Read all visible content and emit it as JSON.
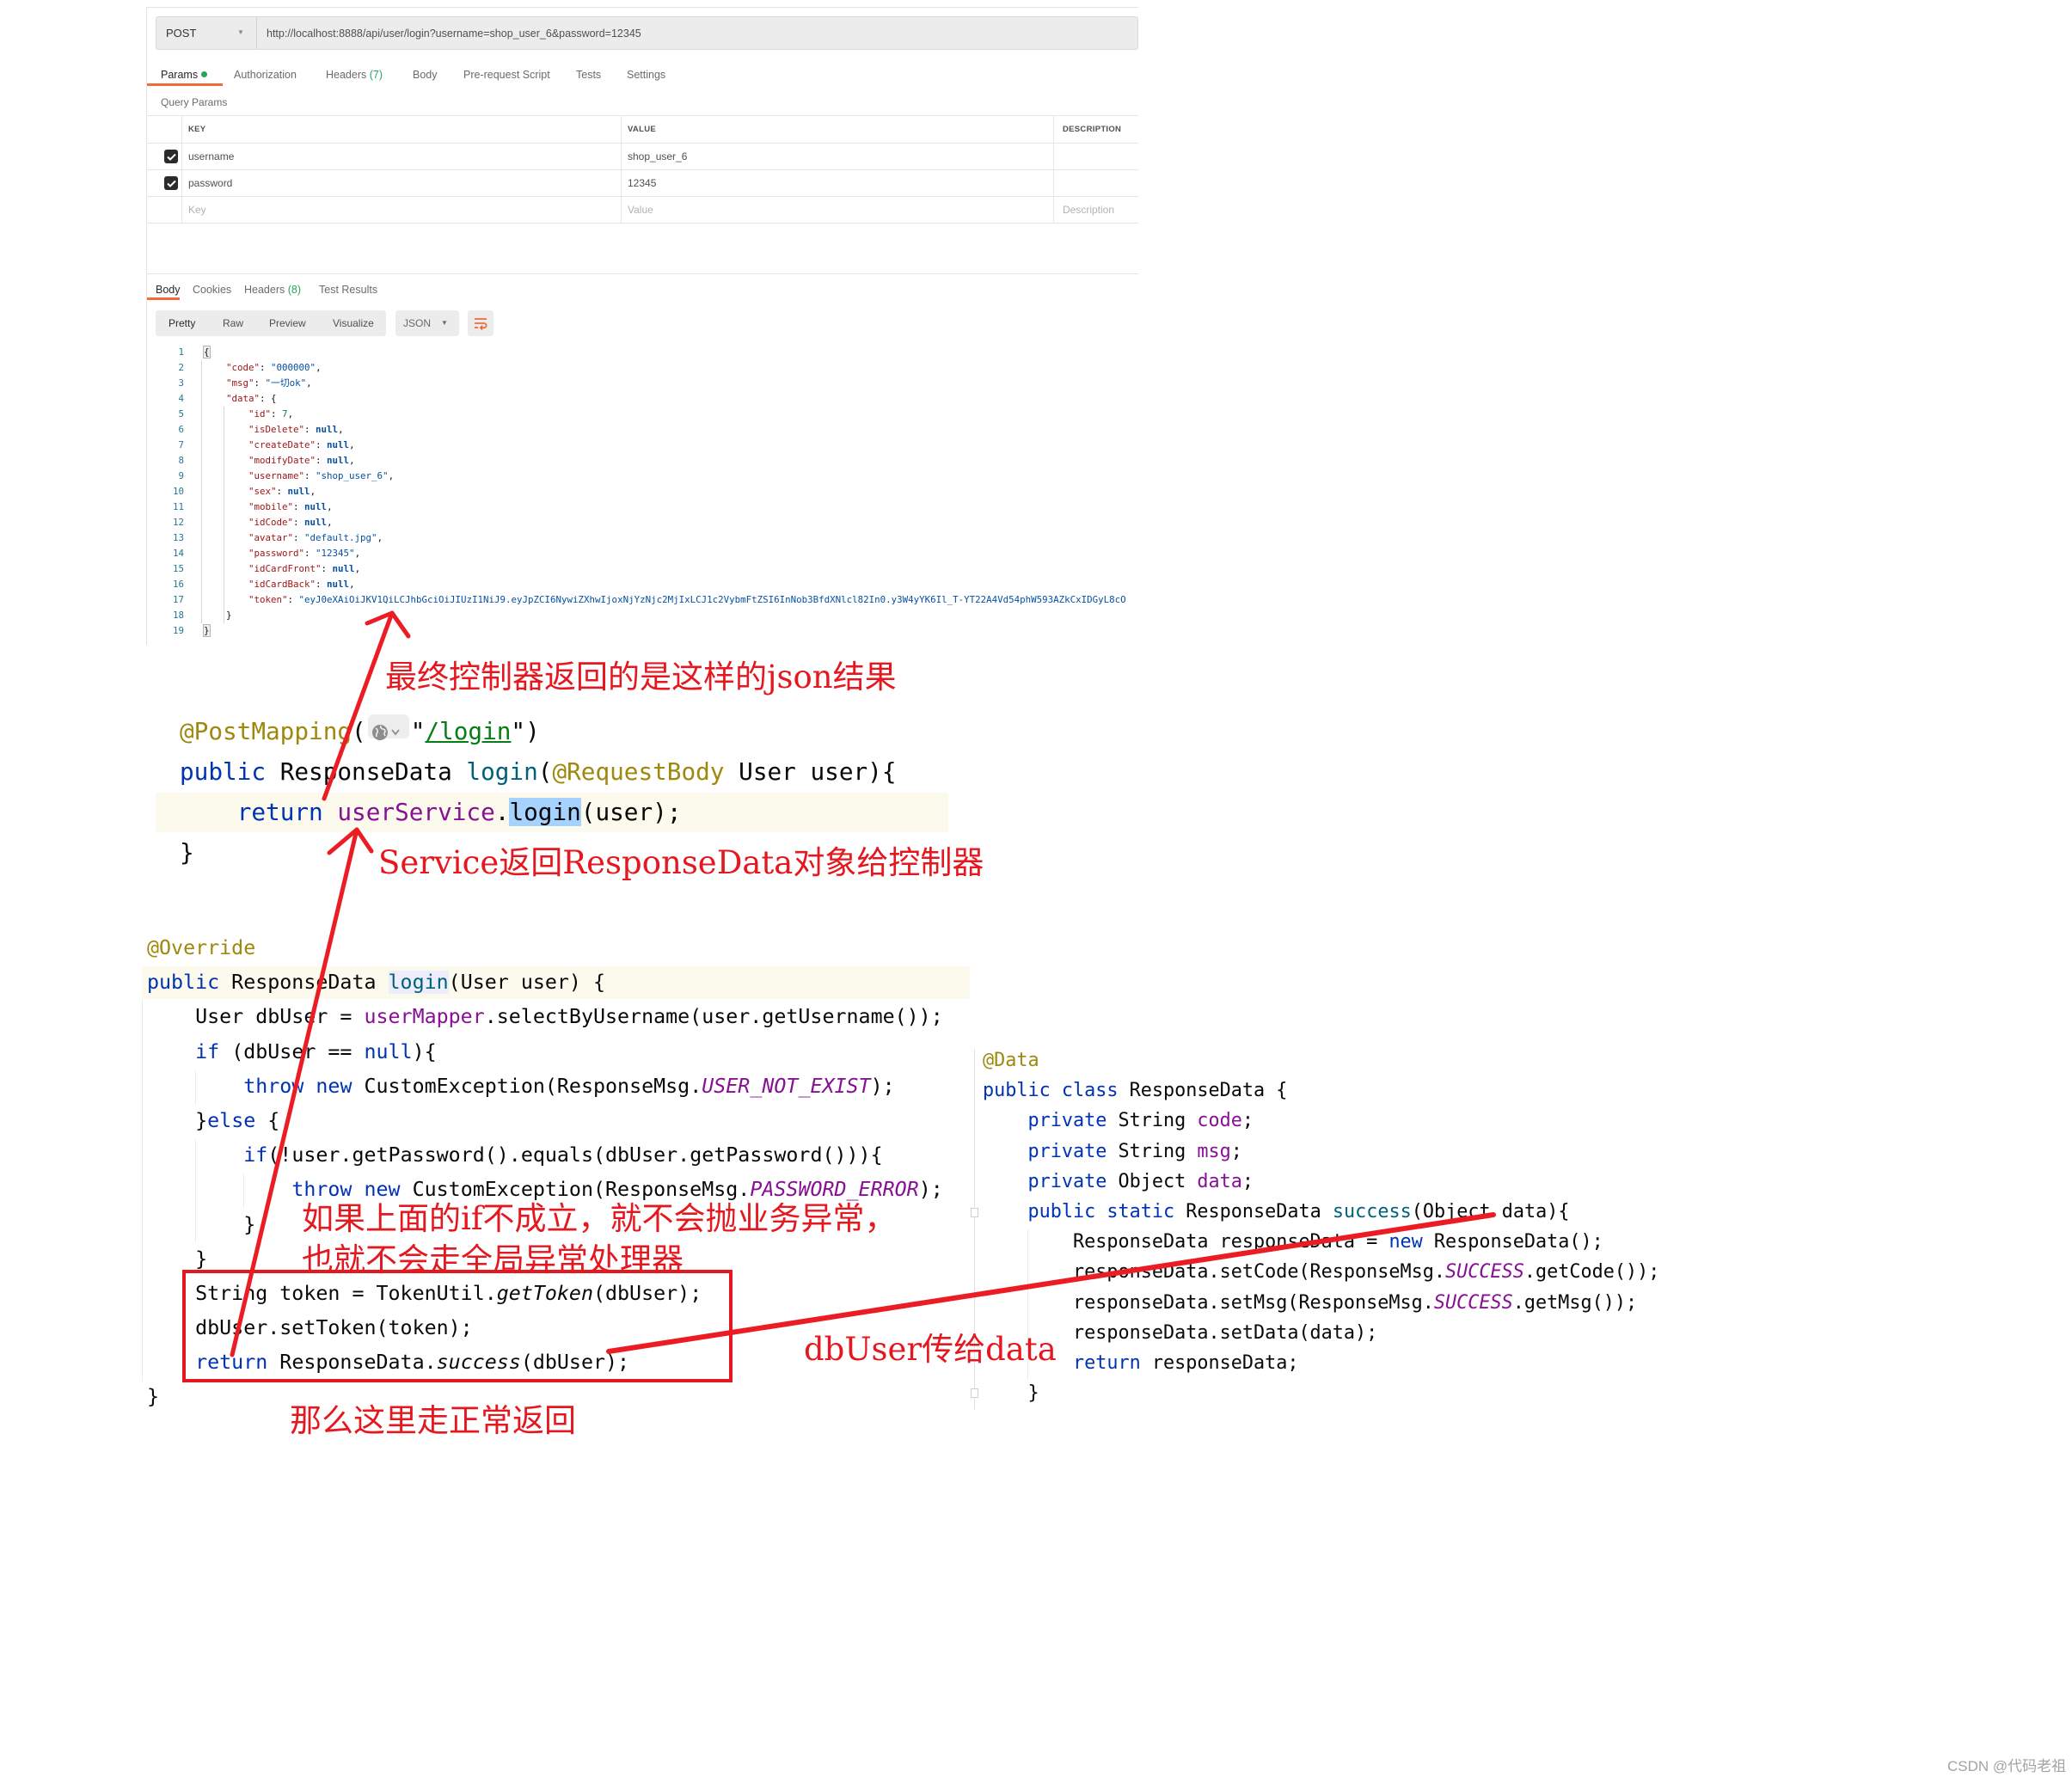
{
  "colors": {
    "postman_accent": "#f26b3a",
    "param_indicator": "#26a65b",
    "annotation_red": "#e5171f"
  },
  "postman": {
    "request": {
      "method": "POST",
      "url": "http://localhost:8888/api/user/login?username=shop_user_6&password=12345"
    },
    "request_tabs": [
      {
        "label": "Params",
        "active": true,
        "indicator": "green-dot"
      },
      {
        "label": "Authorization"
      },
      {
        "label": "Headers",
        "count": "(7)"
      },
      {
        "label": "Body"
      },
      {
        "label": "Pre-request Script"
      },
      {
        "label": "Tests"
      },
      {
        "label": "Settings"
      }
    ],
    "query_params_title": "Query Params",
    "params_table": {
      "headers": [
        "KEY",
        "VALUE",
        "DESCRIPTION"
      ],
      "rows": [
        {
          "checked": true,
          "key": "username",
          "value": "shop_user_6",
          "description": ""
        },
        {
          "checked": true,
          "key": "password",
          "value": "12345",
          "description": ""
        }
      ],
      "placeholders": {
        "key": "Key",
        "value": "Value",
        "description": "Description"
      }
    },
    "response_tabs": [
      {
        "label": "Body",
        "active": true
      },
      {
        "label": "Cookies"
      },
      {
        "label": "Headers",
        "count": "(8)"
      },
      {
        "label": "Test Results"
      }
    ],
    "view_modes": [
      "Pretty",
      "Raw",
      "Preview",
      "Visualize"
    ],
    "format": "JSON",
    "wrap_icon": "wrap-lines-icon",
    "response_lines": [
      {
        "n": "1",
        "tokens": [
          [
            "{",
            "brace"
          ]
        ]
      },
      {
        "n": "2",
        "tokens": [
          [
            "    ",
            "p"
          ],
          [
            "\"code\"",
            "key"
          ],
          [
            ": ",
            "p"
          ],
          [
            "\"000000\"",
            "str"
          ],
          [
            ",",
            "p"
          ]
        ]
      },
      {
        "n": "3",
        "tokens": [
          [
            "    ",
            "p"
          ],
          [
            "\"msg\"",
            "key"
          ],
          [
            ": ",
            "p"
          ],
          [
            "\"一切ok\"",
            "str"
          ],
          [
            ",",
            "p"
          ]
        ]
      },
      {
        "n": "4",
        "tokens": [
          [
            "    ",
            "p"
          ],
          [
            "\"data\"",
            "key"
          ],
          [
            ": {",
            "p"
          ]
        ]
      },
      {
        "n": "5",
        "tokens": [
          [
            "        ",
            "p"
          ],
          [
            "\"id\"",
            "key"
          ],
          [
            ": ",
            "p"
          ],
          [
            "7",
            "num"
          ],
          [
            ",",
            "p"
          ]
        ]
      },
      {
        "n": "6",
        "tokens": [
          [
            "        ",
            "p"
          ],
          [
            "\"isDelete\"",
            "key"
          ],
          [
            ": ",
            "p"
          ],
          [
            "null",
            "null"
          ],
          [
            ",",
            "p"
          ]
        ]
      },
      {
        "n": "7",
        "tokens": [
          [
            "        ",
            "p"
          ],
          [
            "\"createDate\"",
            "key"
          ],
          [
            ": ",
            "p"
          ],
          [
            "null",
            "null"
          ],
          [
            ",",
            "p"
          ]
        ]
      },
      {
        "n": "8",
        "tokens": [
          [
            "        ",
            "p"
          ],
          [
            "\"modifyDate\"",
            "key"
          ],
          [
            ": ",
            "p"
          ],
          [
            "null",
            "null"
          ],
          [
            ",",
            "p"
          ]
        ]
      },
      {
        "n": "9",
        "tokens": [
          [
            "        ",
            "p"
          ],
          [
            "\"username\"",
            "key"
          ],
          [
            ": ",
            "p"
          ],
          [
            "\"shop_user_6\"",
            "str"
          ],
          [
            ",",
            "p"
          ]
        ]
      },
      {
        "n": "10",
        "tokens": [
          [
            "        ",
            "p"
          ],
          [
            "\"sex\"",
            "key"
          ],
          [
            ": ",
            "p"
          ],
          [
            "null",
            "null"
          ],
          [
            ",",
            "p"
          ]
        ]
      },
      {
        "n": "11",
        "tokens": [
          [
            "        ",
            "p"
          ],
          [
            "\"mobile\"",
            "key"
          ],
          [
            ": ",
            "p"
          ],
          [
            "null",
            "null"
          ],
          [
            ",",
            "p"
          ]
        ]
      },
      {
        "n": "12",
        "tokens": [
          [
            "        ",
            "p"
          ],
          [
            "\"idCode\"",
            "key"
          ],
          [
            ": ",
            "p"
          ],
          [
            "null",
            "null"
          ],
          [
            ",",
            "p"
          ]
        ]
      },
      {
        "n": "13",
        "tokens": [
          [
            "        ",
            "p"
          ],
          [
            "\"avatar\"",
            "key"
          ],
          [
            ": ",
            "p"
          ],
          [
            "\"default.jpg\"",
            "str"
          ],
          [
            ",",
            "p"
          ]
        ]
      },
      {
        "n": "14",
        "tokens": [
          [
            "        ",
            "p"
          ],
          [
            "\"password\"",
            "key"
          ],
          [
            ": ",
            "p"
          ],
          [
            "\"12345\"",
            "str"
          ],
          [
            ",",
            "p"
          ]
        ]
      },
      {
        "n": "15",
        "tokens": [
          [
            "        ",
            "p"
          ],
          [
            "\"idCardFront\"",
            "key"
          ],
          [
            ": ",
            "p"
          ],
          [
            "null",
            "null"
          ],
          [
            ",",
            "p"
          ]
        ]
      },
      {
        "n": "16",
        "tokens": [
          [
            "        ",
            "p"
          ],
          [
            "\"idCardBack\"",
            "key"
          ],
          [
            ": ",
            "p"
          ],
          [
            "null",
            "null"
          ],
          [
            ",",
            "p"
          ]
        ]
      },
      {
        "n": "17",
        "tokens": [
          [
            "        ",
            "p"
          ],
          [
            "\"token\"",
            "key"
          ],
          [
            ": ",
            "p"
          ],
          [
            "\"eyJ0eXAiOiJKV1QiLCJhbGciOiJIUzI1NiJ9.eyJpZCI6NywiZXhwIjoxNjYzNjc2MjIxLCJ1c2VybmFtZSI6InNob3BfdXNlcl82In0.y3W4yYK6Il_T-YT22A4Vd54phW593AZkCxIDGyL8cO",
            "str"
          ]
        ]
      },
      {
        "n": "18",
        "tokens": [
          [
            "    ",
            "p"
          ],
          [
            "}",
            "p"
          ]
        ]
      },
      {
        "n": "19",
        "tokens": [
          [
            "}",
            "brace"
          ]
        ]
      }
    ]
  },
  "controller_code": [
    {
      "tokens": [
        [
          "@PostMapping",
          "a"
        ],
        [
          "(",
          "p"
        ],
        [
          "",
          "globe"
        ],
        [
          "\"",
          "p"
        ],
        [
          "/login",
          "s"
        ],
        [
          "\"",
          "p"
        ],
        [
          ")",
          "p"
        ]
      ]
    },
    {
      "tokens": [
        [
          "public",
          "k"
        ],
        [
          " ResponseData ",
          "p"
        ],
        [
          "login",
          "f"
        ],
        [
          "(",
          "p"
        ],
        [
          "@RequestBody",
          "a"
        ],
        [
          " User user){",
          "p"
        ]
      ]
    },
    {
      "tokens": [
        [
          "    ",
          "p"
        ],
        [
          "return",
          "k"
        ],
        [
          " ",
          "p"
        ],
        [
          "userService",
          "v"
        ],
        [
          ".",
          "p"
        ],
        [
          "login",
          "sel"
        ],
        [
          "(user);",
          "p"
        ]
      ]
    },
    {
      "tokens": [
        [
          "}",
          "p"
        ]
      ]
    }
  ],
  "service_code": [
    {
      "tokens": [
        [
          "@Override",
          "a"
        ]
      ]
    },
    {
      "tokens": [
        [
          "public",
          "k"
        ],
        [
          " ResponseData ",
          "p"
        ],
        [
          "login",
          "hl"
        ],
        [
          "(User user) {",
          "p"
        ]
      ]
    },
    {
      "tokens": [
        [
          "    User dbUser = ",
          "p"
        ],
        [
          "userMapper",
          "v"
        ],
        [
          ".selectByUsername(user.getUsername());",
          "p"
        ]
      ]
    },
    {
      "tokens": [
        [
          "    ",
          "p"
        ],
        [
          "if",
          "k"
        ],
        [
          " (dbUser == ",
          "p"
        ],
        [
          "null",
          "k"
        ],
        [
          "){",
          "p"
        ]
      ]
    },
    {
      "tokens": [
        [
          "        ",
          "p"
        ],
        [
          "throw",
          "k"
        ],
        [
          " ",
          "p"
        ],
        [
          "new",
          "k"
        ],
        [
          " CustomException(ResponseMsg.",
          "p"
        ],
        [
          "USER_NOT_EXIST",
          "c"
        ],
        [
          ");",
          "p"
        ]
      ]
    },
    {
      "tokens": [
        [
          "    }",
          "p"
        ],
        [
          "else",
          "k"
        ],
        [
          " {",
          "p"
        ]
      ]
    },
    {
      "tokens": [
        [
          "        ",
          "p"
        ],
        [
          "if",
          "k"
        ],
        [
          "(!user.getPassword().equals(dbUser.getPassword())){",
          "p"
        ]
      ]
    },
    {
      "tokens": [
        [
          "            ",
          "p"
        ],
        [
          "throw",
          "k"
        ],
        [
          " ",
          "p"
        ],
        [
          "new",
          "k"
        ],
        [
          " CustomException(ResponseMsg.",
          "p"
        ],
        [
          "PASSWORD_ERROR",
          "c"
        ],
        [
          ");",
          "p"
        ]
      ]
    },
    {
      "tokens": [
        [
          "        }",
          "p"
        ]
      ]
    },
    {
      "tokens": [
        [
          "    }",
          "p"
        ]
      ]
    },
    {
      "tokens": [
        [
          "    String token = TokenUtil.",
          "p"
        ],
        [
          "getToken",
          "i"
        ],
        [
          "(dbUser);",
          "p"
        ]
      ]
    },
    {
      "tokens": [
        [
          "    dbUser.setToken(token);",
          "p"
        ]
      ]
    },
    {
      "tokens": [
        [
          "    ",
          "p"
        ],
        [
          "return",
          "k"
        ],
        [
          " ResponseData.",
          "p"
        ],
        [
          "success",
          "i"
        ],
        [
          "(dbUser);",
          "p"
        ]
      ]
    },
    {
      "tokens": [
        [
          "}",
          "p"
        ]
      ]
    }
  ],
  "response_class_code": [
    {
      "tokens": [
        [
          "@Data",
          "a"
        ]
      ]
    },
    {
      "tokens": [
        [
          "public",
          "k"
        ],
        [
          " ",
          "p"
        ],
        [
          "class",
          "k"
        ],
        [
          " ResponseData {",
          "p"
        ]
      ]
    },
    {
      "tokens": [
        [
          "    ",
          "p"
        ],
        [
          "private",
          "k"
        ],
        [
          " String ",
          "p"
        ],
        [
          "code",
          "v"
        ],
        [
          ";",
          "p"
        ]
      ]
    },
    {
      "tokens": [
        [
          "    ",
          "p"
        ],
        [
          "private",
          "k"
        ],
        [
          " String ",
          "p"
        ],
        [
          "msg",
          "v"
        ],
        [
          ";",
          "p"
        ]
      ]
    },
    {
      "tokens": [
        [
          "    ",
          "p"
        ],
        [
          "private",
          "k"
        ],
        [
          " Object ",
          "p"
        ],
        [
          "data",
          "v"
        ],
        [
          ";",
          "p"
        ]
      ]
    },
    {
      "tokens": [
        [
          "    ",
          "p"
        ],
        [
          "public",
          "k"
        ],
        [
          " ",
          "p"
        ],
        [
          "static",
          "k"
        ],
        [
          " ResponseData ",
          "p"
        ],
        [
          "success",
          "f"
        ],
        [
          "(Object data){",
          "p"
        ]
      ]
    },
    {
      "tokens": [
        [
          "        ResponseData responseData = ",
          "p"
        ],
        [
          "new",
          "k"
        ],
        [
          " ResponseData();",
          "p"
        ]
      ]
    },
    {
      "tokens": [
        [
          "        responseData.setCode(ResponseMsg.",
          "p"
        ],
        [
          "SUCCESS",
          "c"
        ],
        [
          ".getCode());",
          "p"
        ]
      ]
    },
    {
      "tokens": [
        [
          "        responseData.setMsg(ResponseMsg.",
          "p"
        ],
        [
          "SUCCESS",
          "c"
        ],
        [
          ".getMsg());",
          "p"
        ]
      ]
    },
    {
      "tokens": [
        [
          "        responseData.setData(data);",
          "p"
        ]
      ]
    },
    {
      "tokens": [
        [
          "        ",
          "p"
        ],
        [
          "return",
          "k"
        ],
        [
          " responseData;",
          "p"
        ]
      ]
    },
    {
      "tokens": [
        [
          "    }",
          "p"
        ]
      ]
    }
  ],
  "annotations": {
    "json_result_note": "最终控制器返回的是这样的json结果",
    "service_return_note": "Service返回ResponseData对象给控制器",
    "no_exception_note_line1": "如果上面的if不成立，就不会抛业务异常，",
    "no_exception_note_line2": "也就不会走全局异常处理器",
    "normal_return_note": "那么这里走正常返回",
    "dbuser_to_data_note": "dbUser传给data"
  },
  "watermark": "CSDN @代码老祖"
}
